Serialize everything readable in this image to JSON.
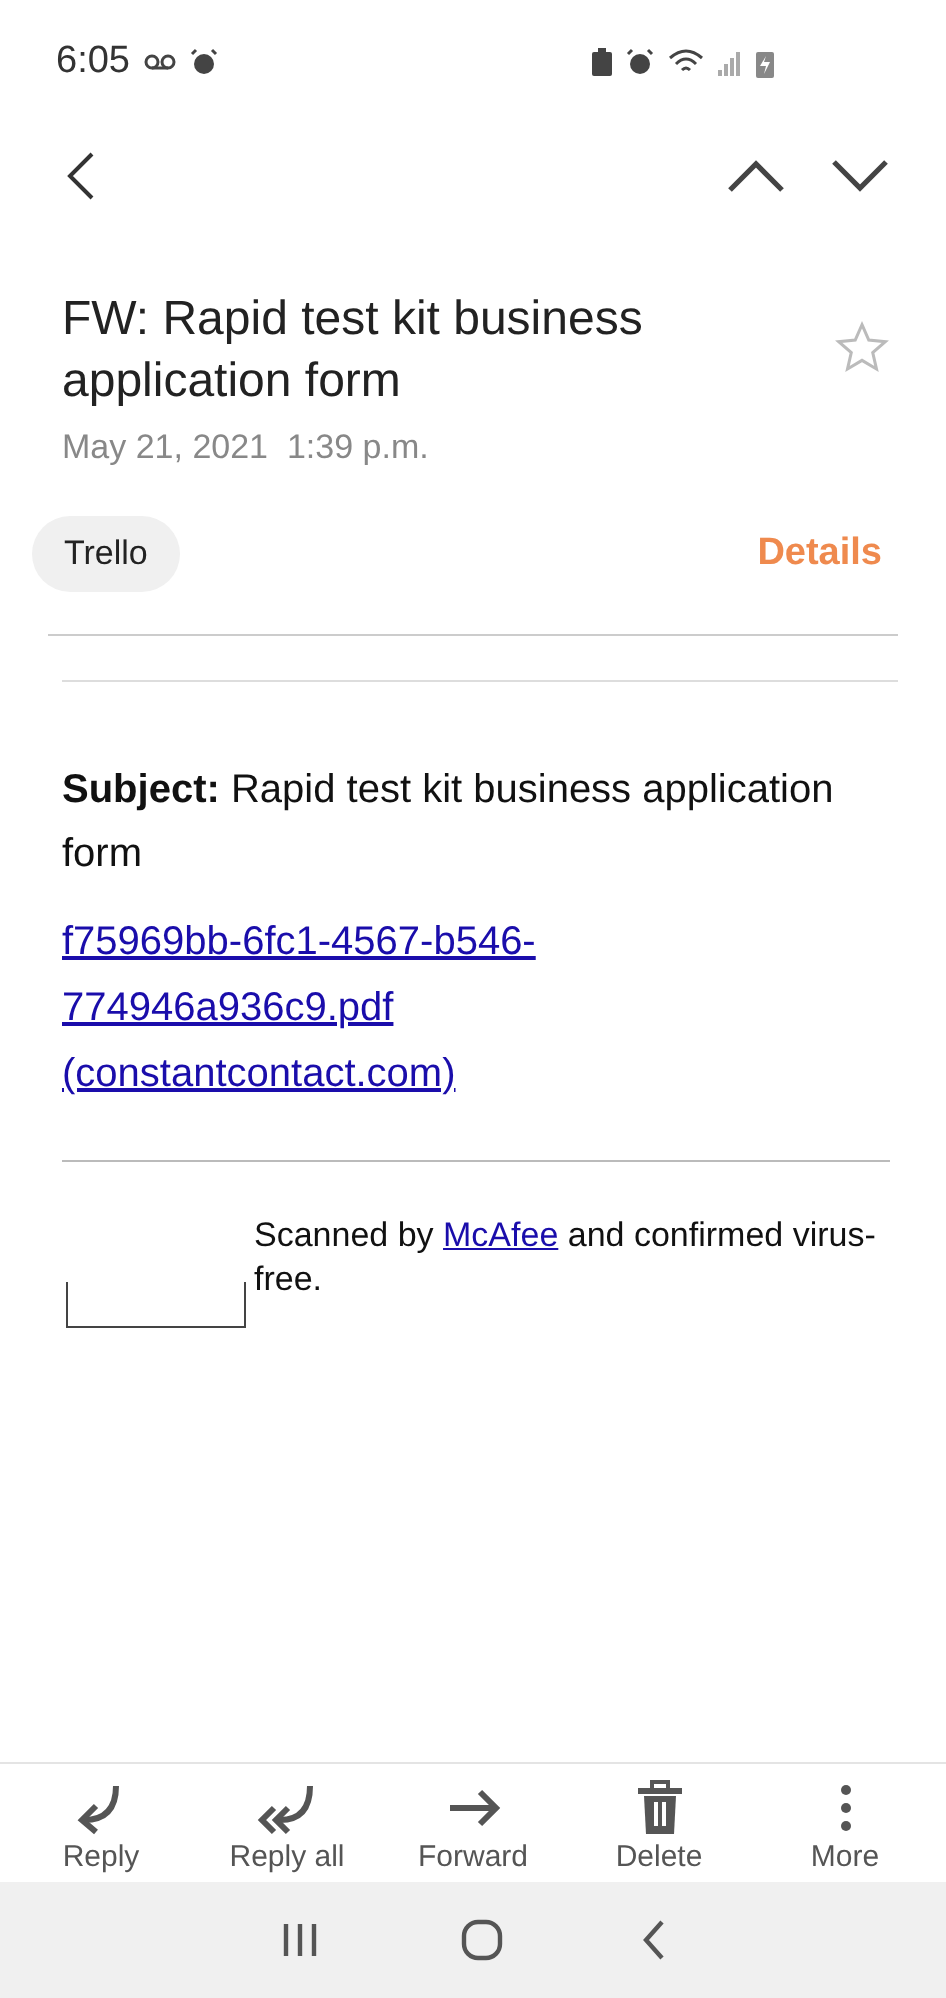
{
  "status_bar": {
    "time": "6:05"
  },
  "email": {
    "subject": "FW: Rapid test kit business application form",
    "starred": false,
    "date": "May 21, 2021  1:39 p.m.",
    "sender": "Trello",
    "details": "Details"
  },
  "body": {
    "subject_label": "Subject:",
    "subject_text": "Rapid test kit business application form",
    "link_lines": [
      "f75969bb-6fc1-4567-b546-",
      "774946a936c9.pdf",
      "(constantcontact.com)"
    ],
    "scan_before": "Scanned by ",
    "scan_link": "McAfee",
    "scan_after": " and confirmed virus-free."
  },
  "toolbar": [
    {
      "kind": "reply",
      "label": "Reply"
    },
    {
      "kind": "reply-all",
      "label": "Reply all"
    },
    {
      "kind": "forward",
      "label": "Forward"
    },
    {
      "kind": "delete",
      "label": "Delete"
    },
    {
      "kind": "more",
      "label": "More"
    }
  ]
}
